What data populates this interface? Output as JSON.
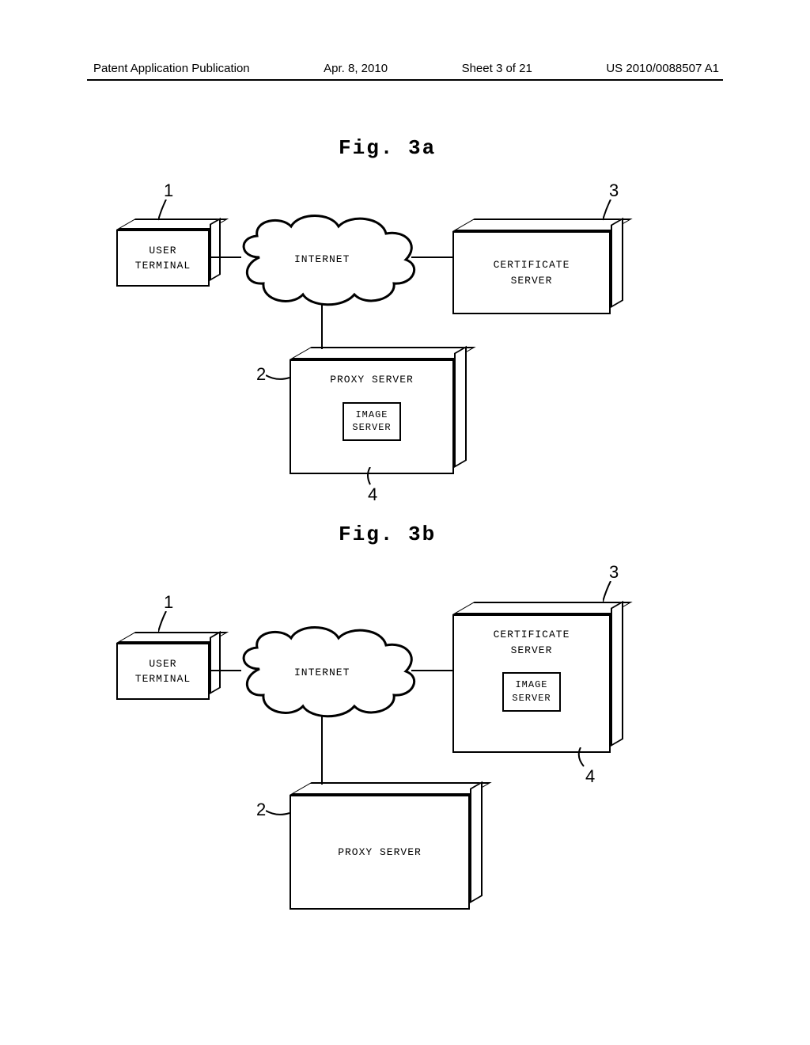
{
  "header": {
    "left": "Patent Application Publication",
    "date": "Apr. 8, 2010",
    "sheet": "Sheet 3 of 21",
    "pubno": "US 2010/0088507 A1"
  },
  "fig_a": {
    "title": "Fig. 3a",
    "user_terminal": "USER\nTERMINAL",
    "internet": "INTERNET",
    "certificate_server": "CERTIFICATE\nSERVER",
    "proxy_server": "PROXY SERVER",
    "image_server": "IMAGE\nSERVER",
    "ref1": "1",
    "ref2": "2",
    "ref3": "3",
    "ref4": "4"
  },
  "fig_b": {
    "title": "Fig. 3b",
    "user_terminal": "USER\nTERMINAL",
    "internet": "INTERNET",
    "certificate_server": "CERTIFICATE\nSERVER",
    "proxy_server": "PROXY SERVER",
    "image_server": "IMAGE\nSERVER",
    "ref1": "1",
    "ref2": "2",
    "ref3": "3",
    "ref4": "4"
  }
}
